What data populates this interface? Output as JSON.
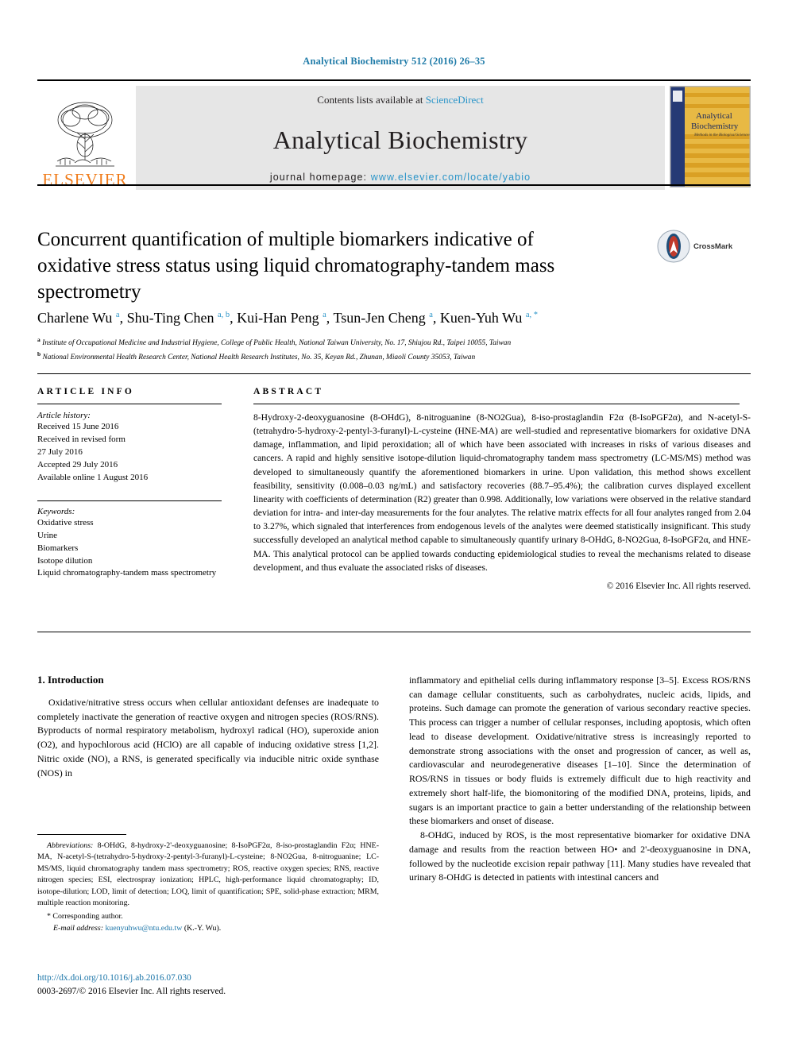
{
  "running_head": "Analytical Biochemistry 512 (2016) 26–35",
  "masthead": {
    "publisher_word": "ELSEVIER",
    "contents_prefix": "Contents lists available at ",
    "contents_link": "ScienceDirect",
    "journal_title": "Analytical Biochemistry",
    "homepage_prefix": "journal homepage: ",
    "homepage_url": "www.elsevier.com/locate/yabio",
    "cover": {
      "line1": "Analytical",
      "line2": "Biochemistry",
      "line3": "Methods in the Biological Sciences"
    },
    "colors": {
      "link": "#2a94c8",
      "elsevier_orange": "#f07c1b",
      "cover_navy": "#263a75",
      "cover_gold": "#e0a92b"
    }
  },
  "article": {
    "title": "Concurrent quantification of multiple biomarkers indicative of oxidative stress status using liquid chromatography-tandem mass spectrometry",
    "crossmark_label": "CrossMark",
    "authors": [
      {
        "name": "Charlene Wu",
        "marks": "a"
      },
      {
        "name": "Shu-Ting Chen",
        "marks": "a, b"
      },
      {
        "name": "Kui-Han Peng",
        "marks": "a"
      },
      {
        "name": "Tsun-Jen Cheng",
        "marks": "a"
      },
      {
        "name": "Kuen-Yuh Wu",
        "marks": "a, *"
      }
    ],
    "affiliations": [
      {
        "mark": "a",
        "text": "Institute of Occupational Medicine and Industrial Hygiene, College of Public Health, National Taiwan University, No. 17, Shiujou Rd., Taipei 10055, Taiwan"
      },
      {
        "mark": "b",
        "text": "National Environmental Health Research Center, National Health Research Institutes, No. 35, Keyan Rd., Zhunan, Miaoli County 35053, Taiwan"
      }
    ]
  },
  "article_info": {
    "kicker": "ARTICLE INFO",
    "history_label": "Article history:",
    "history": [
      "Received 15 June 2016",
      "Received in revised form",
      "27 July 2016",
      "Accepted 29 July 2016",
      "Available online 1 August 2016"
    ],
    "keywords_label": "Keywords:",
    "keywords": [
      "Oxidative stress",
      "Urine",
      "Biomarkers",
      "Isotope dilution",
      "Liquid chromatography-tandem mass spectrometry"
    ]
  },
  "abstract": {
    "kicker": "ABSTRACT",
    "body": "8-Hydroxy-2-deoxyguanosine (8-OHdG), 8-nitroguanine (8-NO2Gua), 8-iso-prostaglandin F2α (8-IsoPGF2α), and N-acetyl-S-(tetrahydro-5-hydroxy-2-pentyl-3-furanyl)-L-cysteine (HNE-MA) are well-studied and representative biomarkers for oxidative DNA damage, inflammation, and lipid peroxidation; all of which have been associated with increases in risks of various diseases and cancers. A rapid and highly sensitive isotope-dilution liquid-chromatography tandem mass spectrometry (LC-MS/MS) method was developed to simultaneously quantify the aforementioned biomarkers in urine. Upon validation, this method shows excellent feasibility, sensitivity (0.008–0.03 ng/mL) and satisfactory recoveries (88.7–95.4%); the calibration curves displayed excellent linearity with coefficients of determination (R2) greater than 0.998. Additionally, low variations were observed in the relative standard deviation for intra- and inter-day measurements for the four analytes. The relative matrix effects for all four analytes ranged from 2.04 to 3.27%, which signaled that interferences from endogenous levels of the analytes were deemed statistically insignificant. This study successfully developed an analytical method capable to simultaneously quantify urinary 8-OHdG, 8-NO2Gua, 8-IsoPGF2α, and HNE-MA. This analytical protocol can be applied towards conducting epidemiological studies to reveal the mechanisms related to disease development, and thus evaluate the associated risks of diseases.",
    "copyright": "© 2016 Elsevier Inc. All rights reserved."
  },
  "introduction": {
    "heading": "1. Introduction",
    "left_paragraph": "Oxidative/nitrative stress occurs when cellular antioxidant defenses are inadequate to completely inactivate the generation of reactive oxygen and nitrogen species (ROS/RNS). Byproducts of normal respiratory metabolism, hydroxyl radical (HO), superoxide anion (O2), and hypochlorous acid (HClO) are all capable of inducing oxidative stress [1,2]. Nitric oxide (NO), a RNS, is generated specifically via inducible nitric oxide synthase (NOS) in",
    "right_paragraph_1": "inflammatory and epithelial cells during inflammatory response [3–5]. Excess ROS/RNS can damage cellular constituents, such as carbohydrates, nucleic acids, lipids, and proteins. Such damage can promote the generation of various secondary reactive species. This process can trigger a number of cellular responses, including apoptosis, which often lead to disease development. Oxidative/nitrative stress is increasingly reported to demonstrate strong associations with the onset and progression of cancer, as well as, cardiovascular and neurodegenerative diseases [1–10]. Since the determination of ROS/RNS in tissues or body fluids is extremely difficult due to high reactivity and extremely short half-life, the biomonitoring of the modified DNA, proteins, lipids, and sugars is an important practice to gain a better understanding of the relationship between these biomarkers and onset of disease.",
    "right_paragraph_2": "8-OHdG, induced by ROS, is the most representative biomarker for oxidative DNA damage and results from the reaction between HO• and 2'-deoxyguanosine in DNA, followed by the nucleotide excision repair pathway [11]. Many studies have revealed that urinary 8-OHdG is detected in patients with intestinal cancers and"
  },
  "footnote": {
    "abbreviations_label": "Abbreviations:",
    "abbreviations_text": "8-OHdG, 8-hydroxy-2'-deoxyguanosine; 8-IsoPGF2α, 8-iso-prostaglandin F2α; HNE-MA, N-acetyl-S-(tetrahydro-5-hydroxy-2-pentyl-3-furanyl)-L-cysteine; 8-NO2Gua, 8-nitroguanine; LC-MS/MS, liquid chromatography tandem mass spectrometry; ROS, reactive oxygen species; RNS, reactive nitrogen species; ESI, electrospray ionization; HPLC, high-performance liquid chromatography; ID, isotope-dilution; LOD, limit of detection; LOQ, limit of quantification; SPE, solid-phase extraction; MRM, multiple reaction monitoring.",
    "corresponding": "Corresponding author.",
    "email_label": "E-mail address:",
    "email": "kuenyuhwu@ntu.edu.tw",
    "email_suffix": "(K.-Y. Wu)."
  },
  "footer": {
    "doi": "http://dx.doi.org/10.1016/j.ab.2016.07.030",
    "issn": "0003-2697/© 2016 Elsevier Inc. All rights reserved."
  }
}
